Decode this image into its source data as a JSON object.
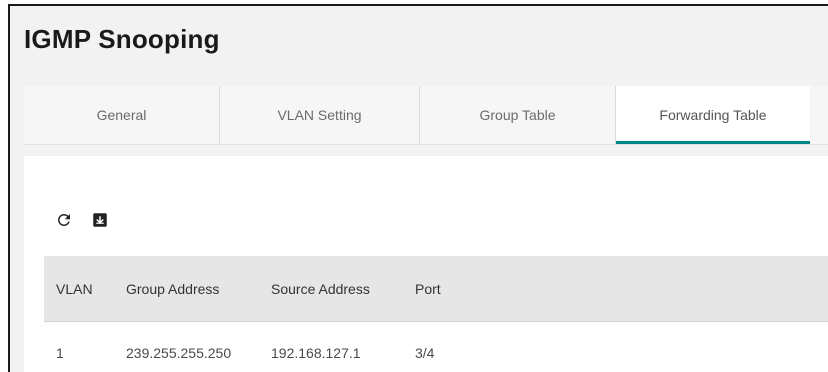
{
  "page": {
    "title": "IGMP Snooping"
  },
  "tabs": [
    {
      "label": "General"
    },
    {
      "label": "VLAN Setting"
    },
    {
      "label": "Group Table"
    },
    {
      "label": "Forwarding Table"
    }
  ],
  "active_tab": "Forwarding Table",
  "toolbar": {
    "refresh_icon": "refresh-icon",
    "export_icon": "download-icon"
  },
  "colors": {
    "accent": "#008787",
    "header_bg": "#e6e6e6"
  },
  "table": {
    "columns": [
      "VLAN",
      "Group Address",
      "Source Address",
      "Port"
    ],
    "rows": [
      [
        "1",
        "239.255.255.250",
        "192.168.127.1",
        "3/4"
      ]
    ]
  }
}
